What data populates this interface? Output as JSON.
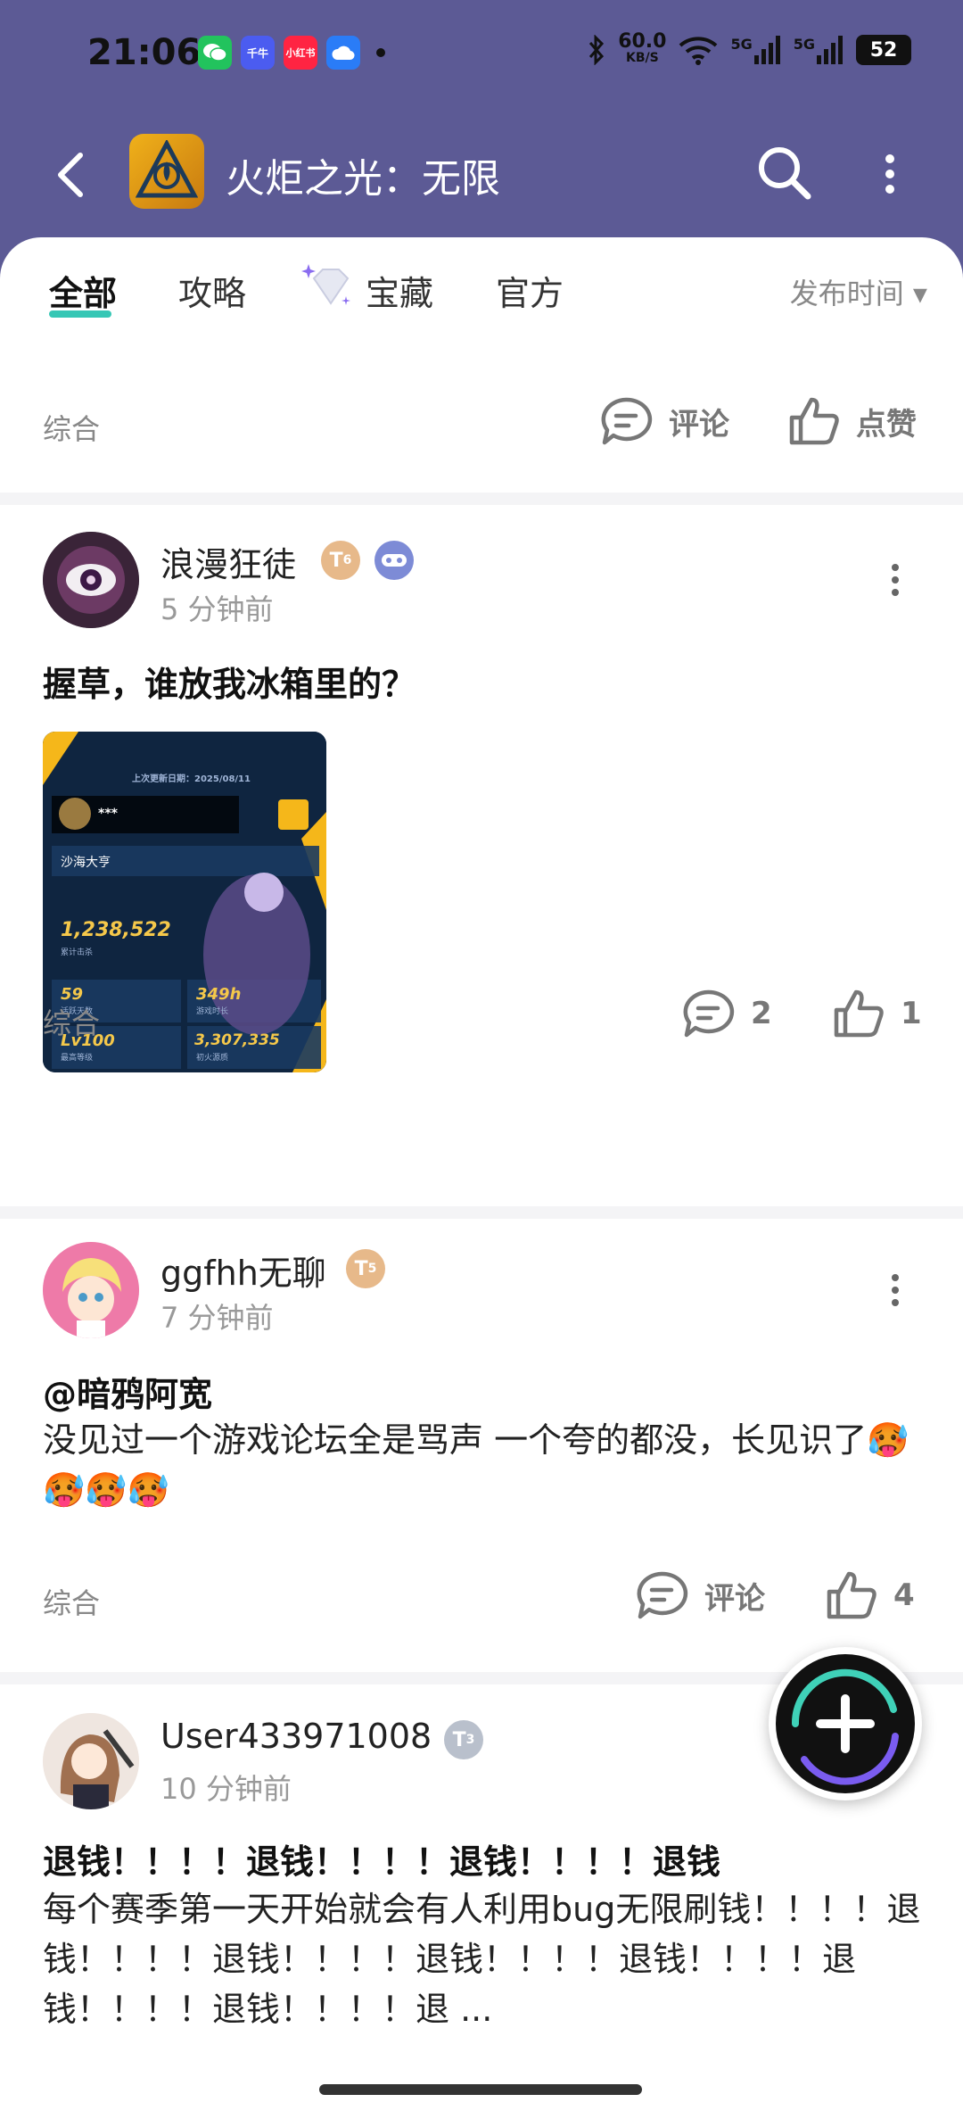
{
  "status": {
    "time": "21:06",
    "apps": [
      {
        "name": "wechat-app-icon",
        "label": "",
        "color": "#22c35d"
      },
      {
        "name": "qianniu-app-icon",
        "label": "千牛",
        "color": "#4b5cf0"
      },
      {
        "name": "xiaohongshu-app-icon",
        "label": "小红书",
        "color": "#ff2442"
      },
      {
        "name": "cloud-app-icon",
        "label": "",
        "color": "#2a7cf7"
      }
    ],
    "speed_value": "60.0",
    "speed_unit": "KB/S",
    "net1": "5G",
    "net2": "5G",
    "battery": "52"
  },
  "header": {
    "title": "火炬之光：无限"
  },
  "tabs": {
    "items": [
      "全部",
      "攻略",
      "宝藏",
      "官方"
    ],
    "active": "全部",
    "sort": "发布时间 ▾"
  },
  "posts": [
    {
      "tag": "综合",
      "comment_label": "评论",
      "like_label": "点赞"
    },
    {
      "username": "浪漫狂徒",
      "level": "6",
      "time": "5 分钟前",
      "title": "握草，谁放我冰箱里的？",
      "image": {
        "date": "上次更新日期：2025/08/11",
        "player": "***",
        "rank": "沙海大亨",
        "big_number": "1,238,522",
        "big_caption": "累计击杀",
        "days": "59",
        "days_caption": "活跃天数",
        "hours": "349h",
        "hours_caption": "游戏时长",
        "level_val": "Lv100",
        "level_caption": "最高等级",
        "fire": "3,307,335",
        "fire_caption": "初火源质"
      },
      "tag": "综合",
      "comments": "2",
      "likes": "1"
    },
    {
      "username": "ggfhh无聊",
      "level": "5",
      "time": "7 分钟前",
      "title": "@暗鸦阿宽",
      "body": "没见过一个游戏论坛全是骂声 一个夸的都没，长见识了🥵🥵🥵🥵",
      "tag": "综合",
      "comment_label": "评论",
      "likes": "4"
    },
    {
      "username": "User433971008",
      "level": "3",
      "time": "10 分钟前",
      "title": "退钱！！！！退钱！！！！退钱！！！！退钱",
      "body": "每个赛季第一天开始就会有人利用bug无限刷钱！！！！退钱！！！！退钱！！！！退钱！！！！退钱！！！！退钱！！！！退钱！！！！退 ..."
    }
  ]
}
